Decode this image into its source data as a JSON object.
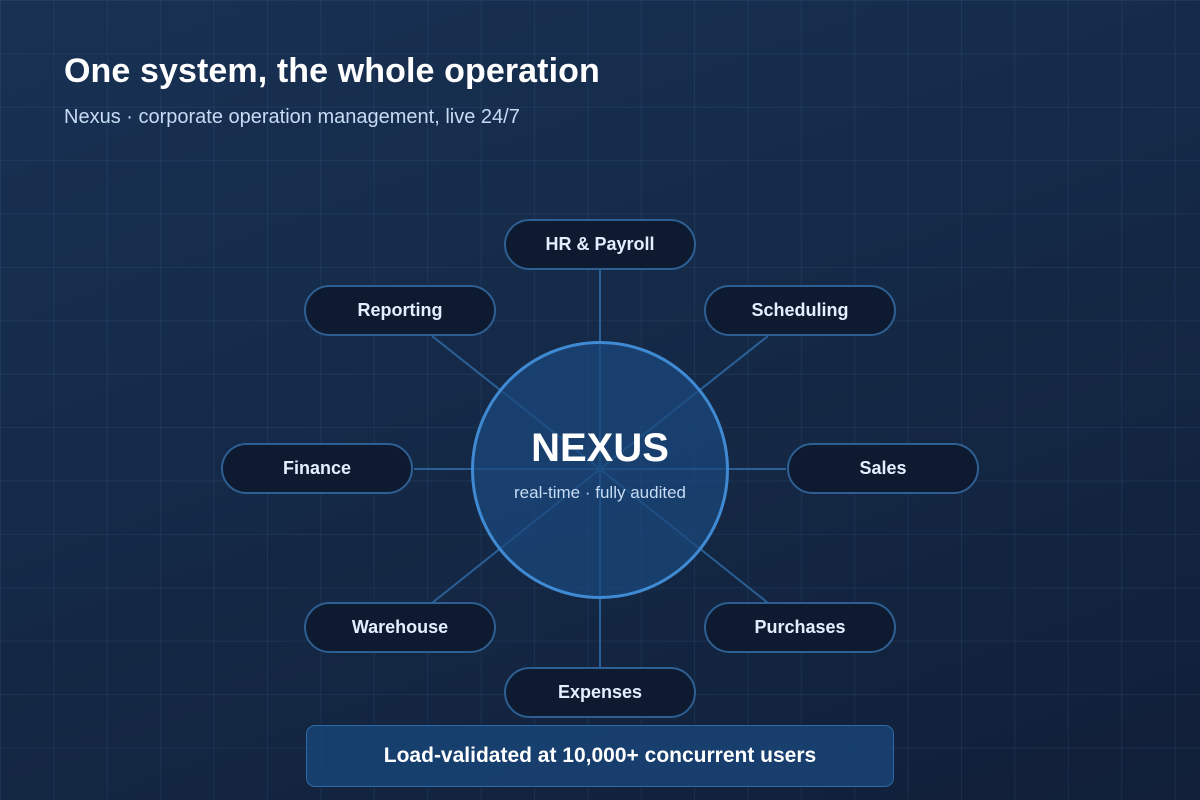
{
  "header": {
    "title": "One system, the whole operation",
    "subtitle": "Nexus · corporate operation management, live 24/7"
  },
  "hub": {
    "title": "NEXUS",
    "subtitle": "real-time · fully audited"
  },
  "modules": [
    {
      "label": "HR & Payroll"
    },
    {
      "label": "Scheduling"
    },
    {
      "label": "Sales"
    },
    {
      "label": "Purchases"
    },
    {
      "label": "Expenses"
    },
    {
      "label": "Warehouse"
    },
    {
      "label": "Finance"
    },
    {
      "label": "Reporting"
    }
  ],
  "footer": {
    "banner": "Load-validated at 10,000+ concurrent users"
  },
  "colors": {
    "background": "#16294a",
    "accent": "#3f8ad3",
    "node_fill": "#0d1a2f",
    "node_border": "#2e5f93",
    "connector": "#2e6aa6"
  }
}
